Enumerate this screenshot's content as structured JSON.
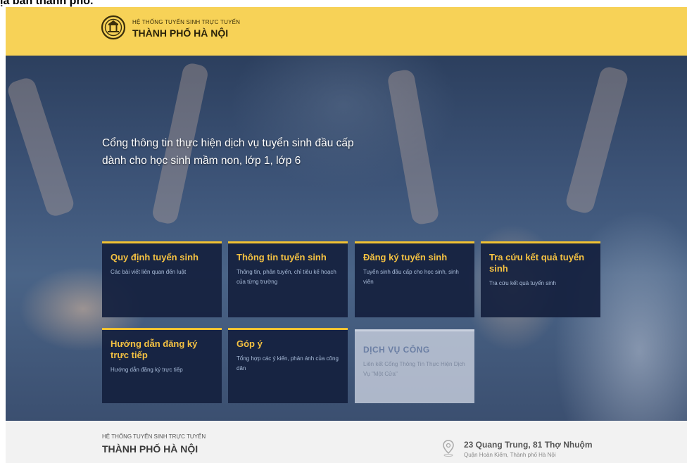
{
  "caption": "ịa bàn thành phố.",
  "header": {
    "subtitle": "HỆ THỐNG TUYỂN SINH TRỰC TUYẾN",
    "title": "THÀNH PHỐ HÀ NỘI"
  },
  "hero": {
    "line1": "Cổng thông tin thực hiện dịch vụ tuyển sinh đầu cấp",
    "line2": "dành cho học sinh mầm non, lớp 1, lớp 6"
  },
  "tiles": [
    {
      "title": "Quy định tuyển sinh",
      "desc": "Các bài viết liên quan đến luật"
    },
    {
      "title": "Thông tin tuyển sinh",
      "desc": "Thông tin, phân tuyến, chỉ tiêu kế hoạch của từng trường"
    },
    {
      "title": "Đăng ký tuyển sinh",
      "desc": "Tuyển sinh đầu cấp cho học sinh, sinh viên"
    },
    {
      "title": "Tra cứu kết quả tuyển sinh",
      "desc": "Tra cứu kết quả tuyển sinh"
    },
    {
      "title": "Hướng dẫn đăng ký trực tiếp",
      "desc": "Hướng dẫn đăng ký trực tiếp"
    },
    {
      "title": "Góp ý",
      "desc": "Tổng hợp các ý kiến, phản ánh của công dân"
    },
    {
      "title": "DỊCH VỤ CÔNG",
      "desc": "Liên kết Cổng Thông Tin Thực Hiện Dịch Vụ \"Một Cửa\""
    }
  ],
  "footer": {
    "subtitle": "HỆ THỐNG TUYỂN SINH TRỰC TUYẾN",
    "title": "THÀNH PHỐ HÀ NỘI",
    "address": "23 Quang Trung, 81 Thợ Nhuộm",
    "district": "Quận Hoàn Kiếm, Thành phố Hà Nội"
  },
  "colors": {
    "header_bg": "#f7d257",
    "tile_bg": "#14203e",
    "tile_title": "#f5c242",
    "accent": "#f1c232"
  }
}
